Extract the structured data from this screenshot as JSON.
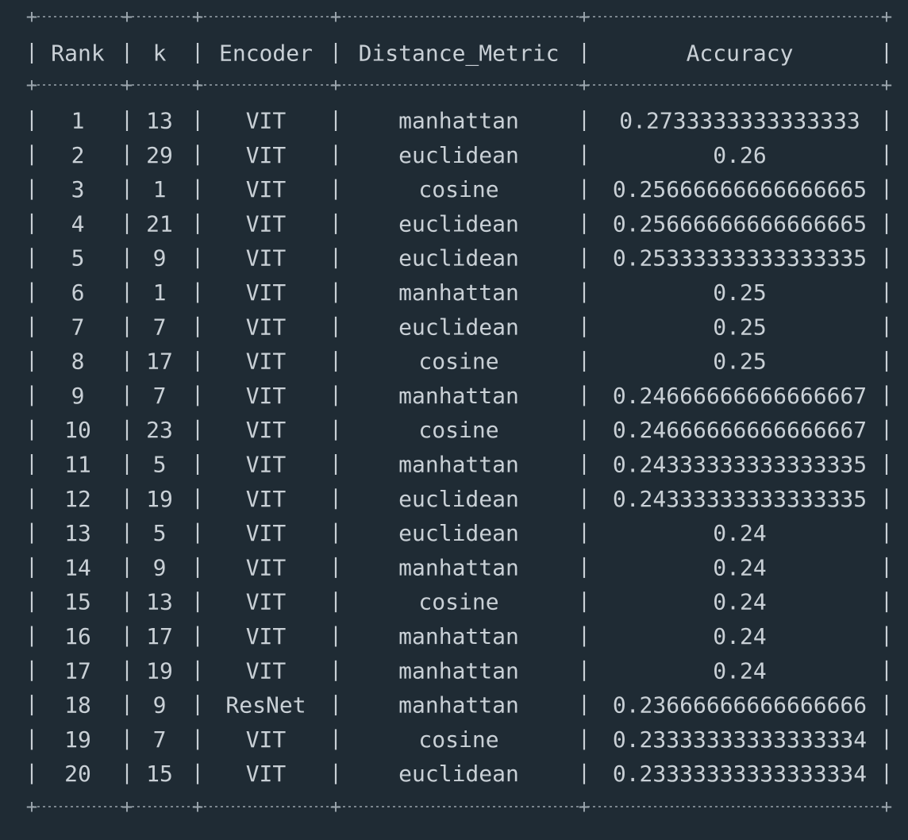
{
  "table": {
    "headers": [
      "Rank",
      "k",
      "Encoder",
      "Distance_Metric",
      "Accuracy"
    ],
    "rows": [
      [
        "1",
        "13",
        "VIT",
        "manhattan",
        "0.2733333333333333"
      ],
      [
        "2",
        "29",
        "VIT",
        "euclidean",
        "0.26"
      ],
      [
        "3",
        "1",
        "VIT",
        "cosine",
        "0.25666666666666665"
      ],
      [
        "4",
        "21",
        "VIT",
        "euclidean",
        "0.25666666666666665"
      ],
      [
        "5",
        "9",
        "VIT",
        "euclidean",
        "0.25333333333333335"
      ],
      [
        "6",
        "1",
        "VIT",
        "manhattan",
        "0.25"
      ],
      [
        "7",
        "7",
        "VIT",
        "euclidean",
        "0.25"
      ],
      [
        "8",
        "17",
        "VIT",
        "cosine",
        "0.25"
      ],
      [
        "9",
        "7",
        "VIT",
        "manhattan",
        "0.24666666666666667"
      ],
      [
        "10",
        "23",
        "VIT",
        "cosine",
        "0.24666666666666667"
      ],
      [
        "11",
        "5",
        "VIT",
        "manhattan",
        "0.24333333333333335"
      ],
      [
        "12",
        "19",
        "VIT",
        "euclidean",
        "0.24333333333333335"
      ],
      [
        "13",
        "5",
        "VIT",
        "euclidean",
        "0.24"
      ],
      [
        "14",
        "9",
        "VIT",
        "manhattan",
        "0.24"
      ],
      [
        "15",
        "13",
        "VIT",
        "cosine",
        "0.24"
      ],
      [
        "16",
        "17",
        "VIT",
        "manhattan",
        "0.24"
      ],
      [
        "17",
        "19",
        "VIT",
        "manhattan",
        "0.24"
      ],
      [
        "18",
        "9",
        "ResNet",
        "manhattan",
        "0.23666666666666666"
      ],
      [
        "19",
        "7",
        "VIT",
        "cosine",
        "0.23333333333333334"
      ],
      [
        "20",
        "15",
        "VIT",
        "euclidean",
        "0.23333333333333334"
      ]
    ]
  },
  "colors": {
    "background": "#1f2b34",
    "text": "#c9d0d6",
    "border": "#9aa4ac"
  }
}
